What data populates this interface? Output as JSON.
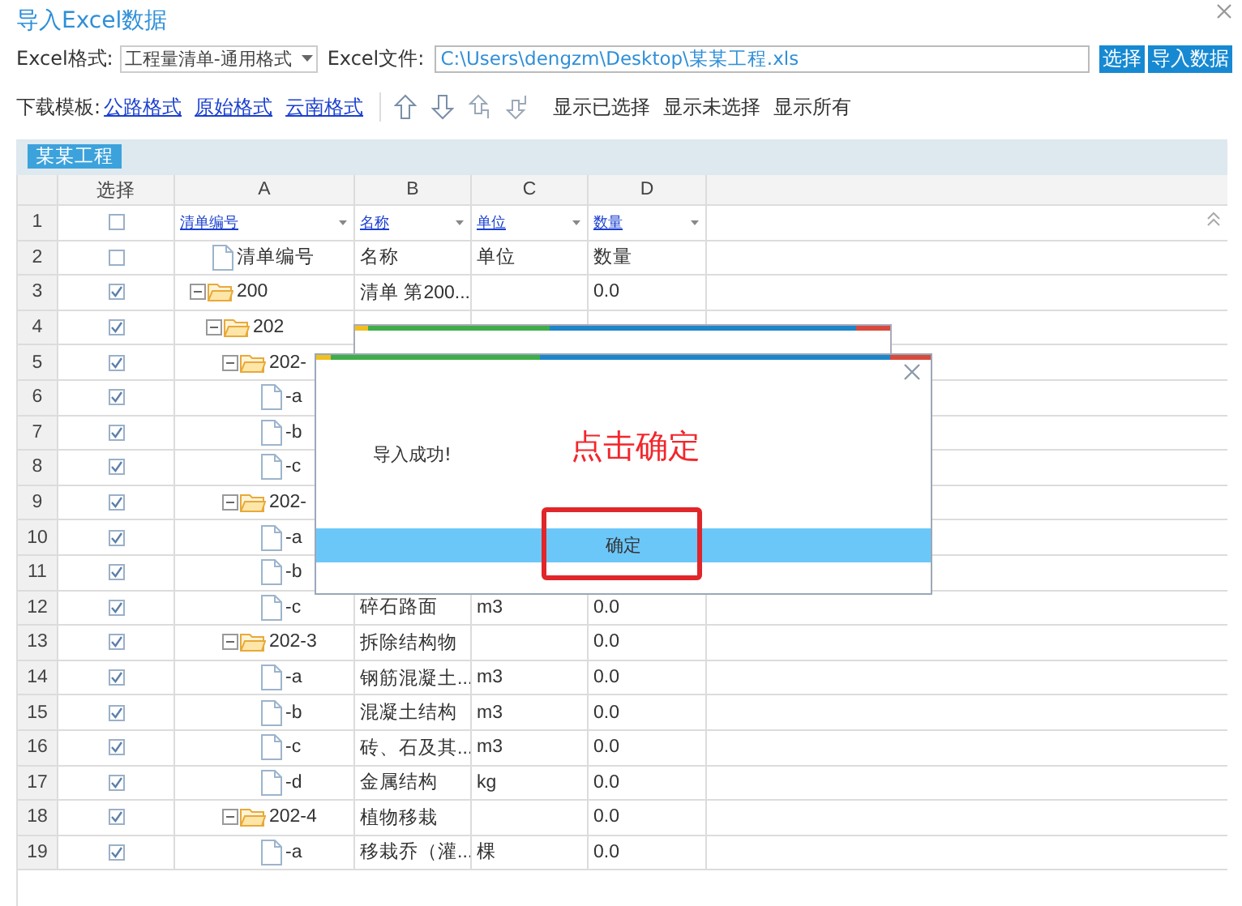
{
  "window": {
    "title": "导入Excel数据"
  },
  "format_row": {
    "format_label": "Excel格式:",
    "format_select": "工程量清单-通用格式",
    "file_label": "Excel文件:",
    "file_path": "C:\\Users\\dengzm\\Desktop\\某某工程.xls",
    "buttons": [
      "选择",
      "导入数据"
    ]
  },
  "template_row": {
    "label": "下载模板:",
    "links": [
      "公路格式",
      "原始格式",
      "云南格式"
    ],
    "filters": [
      "显示已选择",
      "显示未选择",
      "显示所有"
    ]
  },
  "sheet_tabs": [
    {
      "label": "某某工程",
      "selected": true
    }
  ],
  "grid": {
    "columns": [
      "选择",
      "A",
      "B",
      "C",
      "D"
    ],
    "filter_row": {
      "number": "1",
      "checked": false,
      "filters": [
        "清单编号",
        "名称",
        "单位",
        "数量"
      ]
    },
    "rows": [
      {
        "number": "2",
        "checked": false,
        "kind": "file",
        "code": "清单编号",
        "name": "名称",
        "unit": "单位",
        "qty": "数量"
      },
      {
        "number": "3",
        "checked": true,
        "kind": "folder",
        "expanded": true,
        "code": "200",
        "name": "清单 第200...",
        "qty": "0.0",
        "children": [
          {
            "number": "4",
            "checked": true,
            "kind": "folder",
            "expanded": true,
            "code": "202",
            "children": [
              {
                "number": "5",
                "checked": true,
                "kind": "folder",
                "expanded": true,
                "code": "202-",
                "children": [
                  {
                    "number": "6",
                    "checked": true,
                    "kind": "file",
                    "code": "-a"
                  },
                  {
                    "number": "7",
                    "checked": true,
                    "kind": "file",
                    "code": "-b"
                  },
                  {
                    "number": "8",
                    "checked": true,
                    "kind": "file",
                    "code": "-c"
                  }
                ]
              },
              {
                "number": "9",
                "checked": true,
                "kind": "folder",
                "expanded": true,
                "code": "202-",
                "children": [
                  {
                    "number": "10",
                    "checked": true,
                    "kind": "file",
                    "code": "-a"
                  },
                  {
                    "number": "11",
                    "checked": true,
                    "kind": "file",
                    "code": "-b"
                  },
                  {
                    "number": "12",
                    "checked": true,
                    "kind": "file",
                    "code": "-c",
                    "name": "碎石路面",
                    "unit": "m3",
                    "qty": "0.0"
                  }
                ]
              },
              {
                "number": "13",
                "checked": true,
                "kind": "folder",
                "expanded": true,
                "code": "202-3",
                "name": "拆除结构物",
                "qty": "0.0",
                "children": [
                  {
                    "number": "14",
                    "checked": true,
                    "kind": "file",
                    "code": "-a",
                    "name": "钢筋混凝土...",
                    "unit": "m3",
                    "qty": "0.0"
                  },
                  {
                    "number": "15",
                    "checked": true,
                    "kind": "file",
                    "code": "-b",
                    "name": "混凝土结构",
                    "unit": "m3",
                    "qty": "0.0"
                  },
                  {
                    "number": "16",
                    "checked": true,
                    "kind": "file",
                    "code": "-c",
                    "name": "砖、石及其...",
                    "unit": "m3",
                    "qty": "0.0"
                  },
                  {
                    "number": "17",
                    "checked": true,
                    "kind": "file",
                    "code": "-d",
                    "name": "金属结构",
                    "unit": "kg",
                    "qty": "0.0"
                  }
                ]
              },
              {
                "number": "18",
                "checked": true,
                "kind": "folder",
                "expanded": true,
                "code": "202-4",
                "name": "植物移栽",
                "qty": "0.0",
                "children": [
                  {
                    "number": "19",
                    "checked": true,
                    "kind": "file",
                    "code": "-a",
                    "name": "移栽乔（灌...",
                    "unit": "棵",
                    "qty": "0.0"
                  }
                ]
              }
            ]
          }
        ]
      }
    ]
  },
  "dialog": {
    "message": "导入成功!",
    "button": "确定"
  },
  "annotation": {
    "text": "点击确定"
  }
}
